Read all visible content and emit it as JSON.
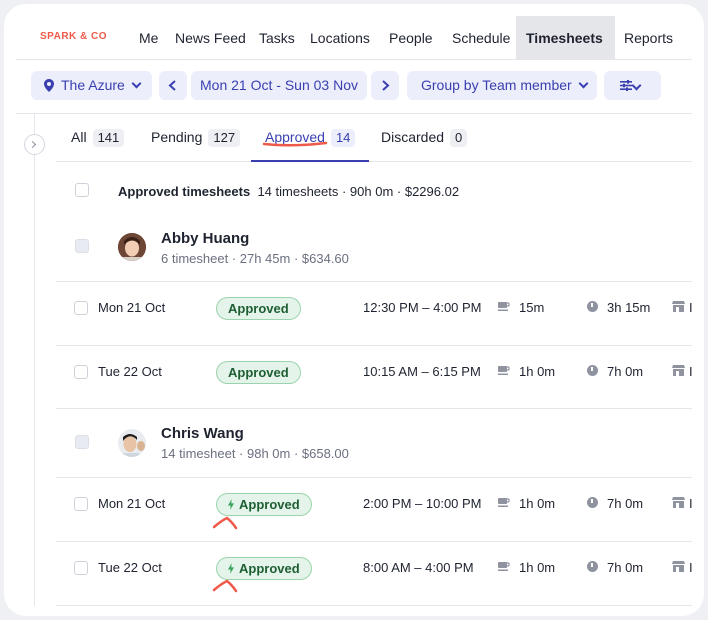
{
  "nav": {
    "logo": "SPARK & CO",
    "items": [
      "Me",
      "News Feed",
      "Tasks",
      "Locations",
      "People",
      "Schedule",
      "Timesheets",
      "Reports"
    ]
  },
  "toolbar": {
    "location": "The Azure",
    "date_range": "Mon 21 Oct - Sun 03 Nov",
    "group_by": "Group by Team member"
  },
  "tabs": [
    {
      "label": "All",
      "count": "141"
    },
    {
      "label": "Pending",
      "count": "127"
    },
    {
      "label": "Approved",
      "count": "14"
    },
    {
      "label": "Discarded",
      "count": "0"
    }
  ],
  "summary": {
    "title": "Approved timesheets",
    "details": "14 timesheets · 90h 0m · $2296.02"
  },
  "people": [
    {
      "name": "Abby Huang",
      "sub": "6 timesheet · 27h 45m · $634.60",
      "rows": [
        {
          "date": "Mon 21 Oct",
          "status": "Approved",
          "time": "12:30 PM – 4:00 PM",
          "break": "15m",
          "duration": "3h 15m",
          "trunc": "I"
        },
        {
          "date": "Tue 22 Oct",
          "status": "Approved",
          "time": "10:15 AM – 6:15 PM",
          "break": "1h 0m",
          "duration": "7h 0m",
          "trunc": "I"
        }
      ]
    },
    {
      "name": "Chris Wang",
      "sub": "14 timesheet · 98h 0m · $658.00",
      "rows": [
        {
          "date": "Mon 21 Oct",
          "status": "Approved",
          "time": "2:00 PM – 10:00 PM",
          "break": "1h 0m",
          "duration": "7h 0m",
          "trunc": "I"
        },
        {
          "date": "Tue 22 Oct",
          "status": "Approved",
          "time": "8:00 AM – 4:00 PM",
          "break": "1h 0m",
          "duration": "7h 0m",
          "trunc": "I"
        }
      ]
    }
  ],
  "colors": {
    "accent": "#3a3fb0",
    "brand": "#ee5a4a",
    "approved_bg": "#e5f4ea",
    "approved_border": "#9bd3ad",
    "annotation": "#ee5a4a"
  },
  "icons": [
    "location-pin-icon",
    "chevron-left-icon",
    "chevron-right-icon",
    "chevron-down-icon",
    "filter-sliders-icon",
    "collapse-chevron-icon",
    "coffee-cup-icon",
    "clock-icon",
    "store-icon",
    "bolt-icon"
  ]
}
